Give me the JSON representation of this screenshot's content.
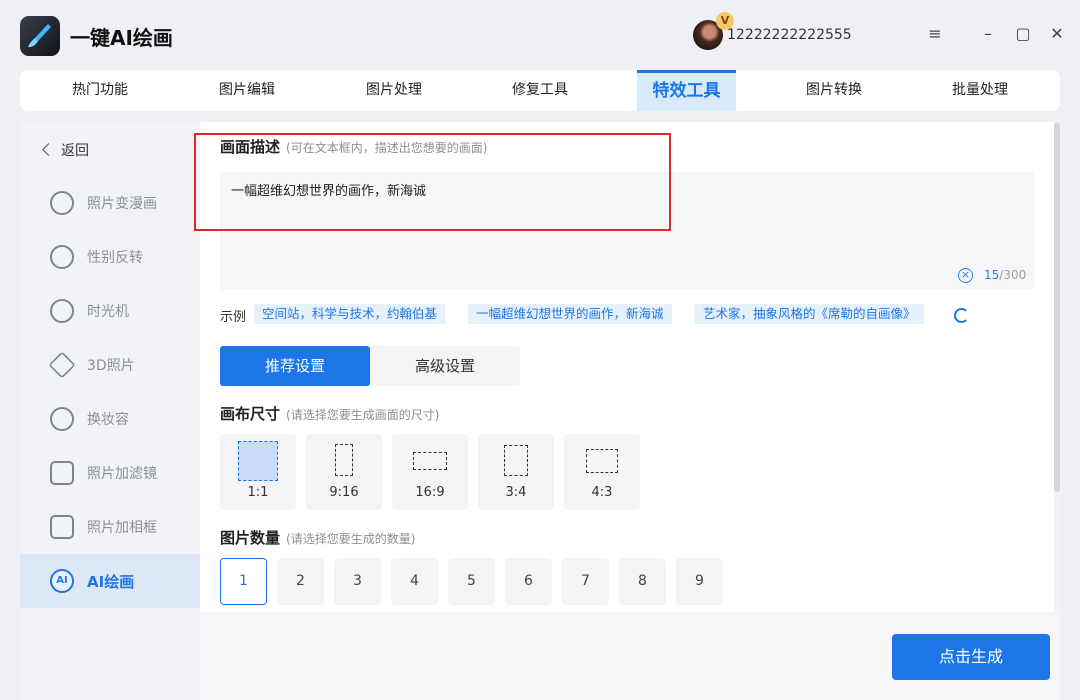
{
  "app": {
    "title": "一键AI绘画",
    "user_id": "12222222222555",
    "vip": "V"
  },
  "window": {
    "menu": "≡",
    "minimize": "–",
    "maximize": "▢",
    "close": "✕"
  },
  "main_nav": [
    "热门功能",
    "图片编辑",
    "图片处理",
    "修复工具",
    "特效工具",
    "图片转换",
    "批量处理"
  ],
  "sidebar": {
    "back": "返回",
    "items": [
      {
        "label": "照片变漫画",
        "icon": "comic-face-icon"
      },
      {
        "label": "性别反转",
        "icon": "gender-icon"
      },
      {
        "label": "时光机",
        "icon": "clock-icon"
      },
      {
        "label": "3D照片",
        "icon": "layers-icon"
      },
      {
        "label": "换妆容",
        "icon": "makeup-icon"
      },
      {
        "label": "照片加滤镜",
        "icon": "filter-icon"
      },
      {
        "label": "照片加相框",
        "icon": "frame-icon"
      },
      {
        "label": "AI绘画",
        "icon": "ai-paint-icon",
        "badge": "AI"
      }
    ]
  },
  "description": {
    "title": "画面描述",
    "hint": "(可在文本框内，描述出您想要的画面)",
    "value": "一幅超维幻想世界的画作，新海诚",
    "clear": "×",
    "count": "15",
    "max": "/300"
  },
  "examples": {
    "label": "示例",
    "items": [
      "空间站，科学与技术，约翰伯基",
      "一幅超维幻想世界的画作，新海诚",
      "艺术家，抽象风格的《席勒的自画像》"
    ]
  },
  "settings_tabs": {
    "recommended": "推荐设置",
    "advanced": "高级设置"
  },
  "canvas_size": {
    "title": "画布尺寸",
    "hint": "(请选择您要生成画面的尺寸)",
    "options": [
      "1:1",
      "9:16",
      "16:9",
      "3:4",
      "4:3"
    ]
  },
  "image_count": {
    "title": "图片数量",
    "hint": "(请选择您要生成的数量)",
    "options": [
      "1",
      "2",
      "3",
      "4",
      "5",
      "6",
      "7",
      "8",
      "9"
    ]
  },
  "generate_button": "点击生成",
  "colors": {
    "accent": "#1d76e8",
    "highlight": "#d92b2b"
  }
}
